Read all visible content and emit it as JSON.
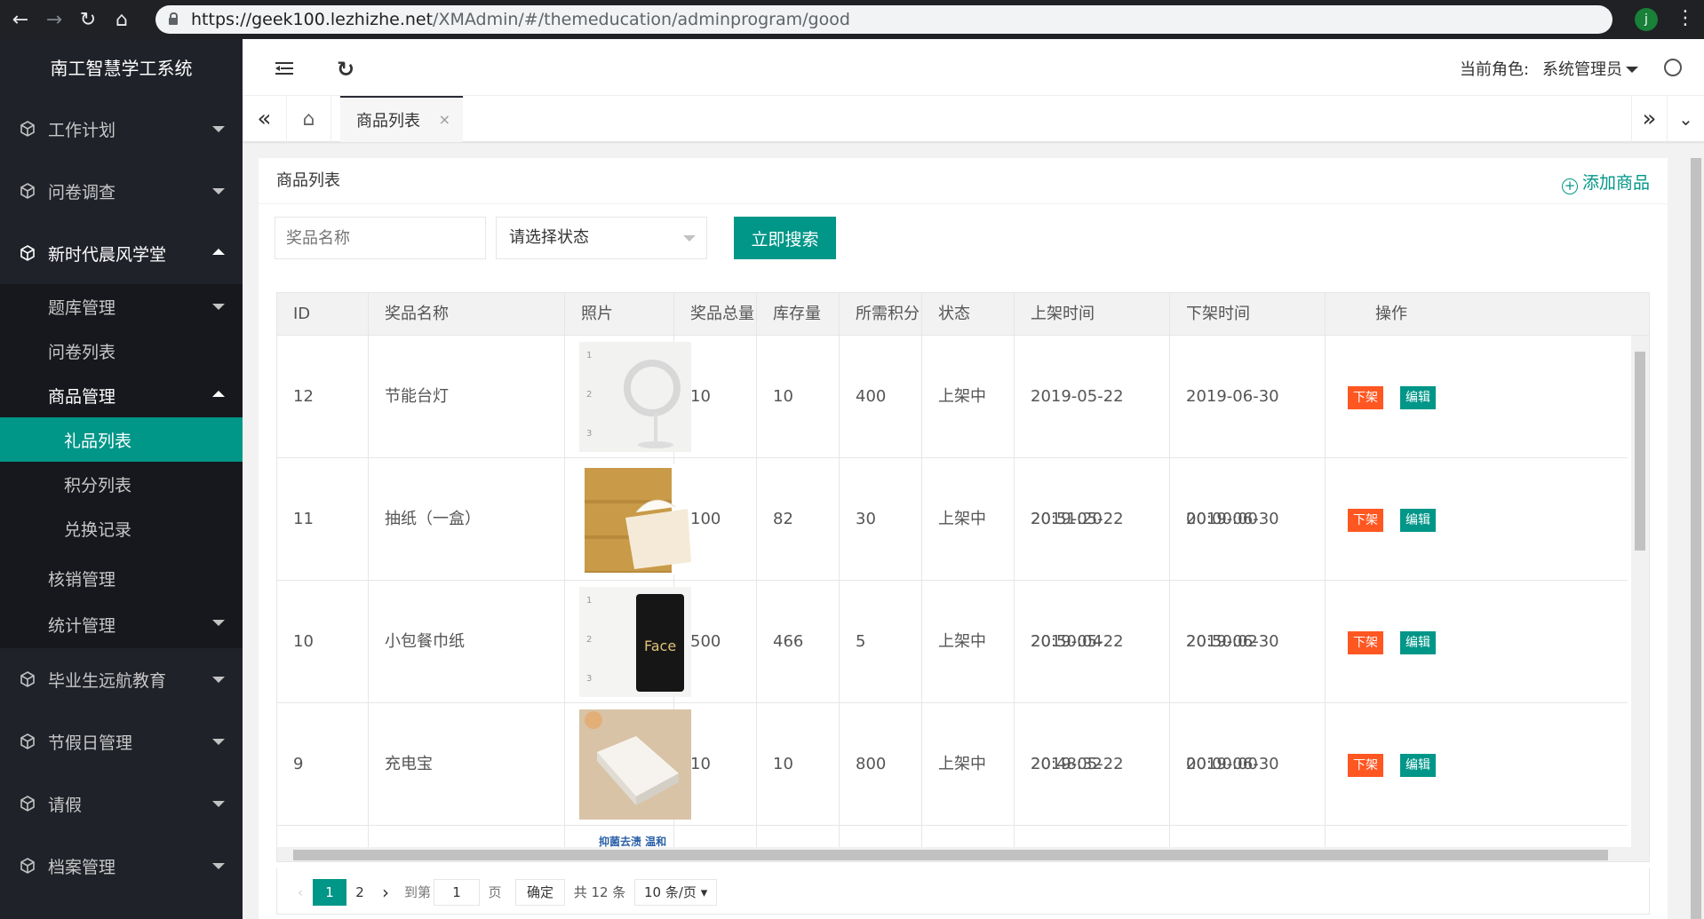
{
  "browser": {
    "url_host": "https://geek100.lezhizhe.net",
    "url_path": "/XMAdmin/#/themeducation/adminprogram/good",
    "avatar_letter": "j"
  },
  "sidebar": {
    "logo": "南工智慧学工系统",
    "menus": [
      {
        "label": "工作计划"
      },
      {
        "label": "问卷调查"
      },
      {
        "label": "新时代晨风学堂"
      },
      {
        "label": "毕业生远航教育"
      },
      {
        "label": "节假日管理"
      },
      {
        "label": "请假"
      },
      {
        "label": "档案管理"
      }
    ],
    "sub": [
      {
        "label": "题库管理"
      },
      {
        "label": "问卷列表"
      },
      {
        "label": "商品管理"
      },
      {
        "label": "核销管理"
      },
      {
        "label": "统计管理"
      }
    ],
    "third": [
      {
        "label": "礼品列表"
      },
      {
        "label": "积分列表"
      },
      {
        "label": "兑换记录"
      }
    ]
  },
  "topbar": {
    "role_label": "当前角色:",
    "role_value": "系统管理员"
  },
  "tabs": {
    "active": "商品列表"
  },
  "card": {
    "title": "商品列表",
    "add_label": "添加商品"
  },
  "search": {
    "name_placeholder": "奖品名称",
    "status_placeholder": "请选择状态",
    "button": "立即搜索"
  },
  "table": {
    "headers": [
      "ID",
      "奖品名称",
      "照片",
      "奖品总量",
      "库存量",
      "所需积分",
      "状态",
      "上架时间",
      "下架时间",
      "操作"
    ],
    "rows": [
      {
        "id": "12",
        "name": "节能台灯",
        "total": "10",
        "stock": "10",
        "points": "400",
        "status": "上架中",
        "on": "2019-05-22 20:51:20",
        "off": "2019-06-30 00:00:00",
        "op1": "下架",
        "op2": "编辑"
      },
      {
        "id": "11",
        "name": "抽纸（一盒）",
        "total": "100",
        "stock": "82",
        "points": "30",
        "status": "上架中",
        "on": "2019-05-22 20:50:04",
        "off": "2019-06-30 20:50:02",
        "op1": "下架",
        "op2": "编辑"
      },
      {
        "id": "10",
        "name": "小包餐巾纸",
        "total": "500",
        "stock": "466",
        "points": "5",
        "status": "上架中",
        "on": "2019-05-22 20:48:32",
        "off": "2019-06-30 00:00:00",
        "op1": "下架",
        "op2": "编辑"
      },
      {
        "id": "9",
        "name": "充电宝",
        "total": "10",
        "stock": "10",
        "points": "800",
        "status": "上架中",
        "on": "2019-05-22 20:47:34",
        "off": "2019-06-30 00:00:00",
        "op1": "下架",
        "op2": "编辑"
      }
    ],
    "partial_photo_caption": "抑菌去渍 温和柔顺"
  },
  "pager": {
    "page1": "1",
    "page2": "2",
    "goto_label": "到第",
    "goto_value": "1",
    "page_unit": "页",
    "confirm": "确定",
    "total": "共 12 条",
    "per_page": "10 条/页"
  },
  "colors": {
    "accent": "#009688",
    "danger": "#ff5722",
    "sidebar_bg": "#20222a"
  }
}
